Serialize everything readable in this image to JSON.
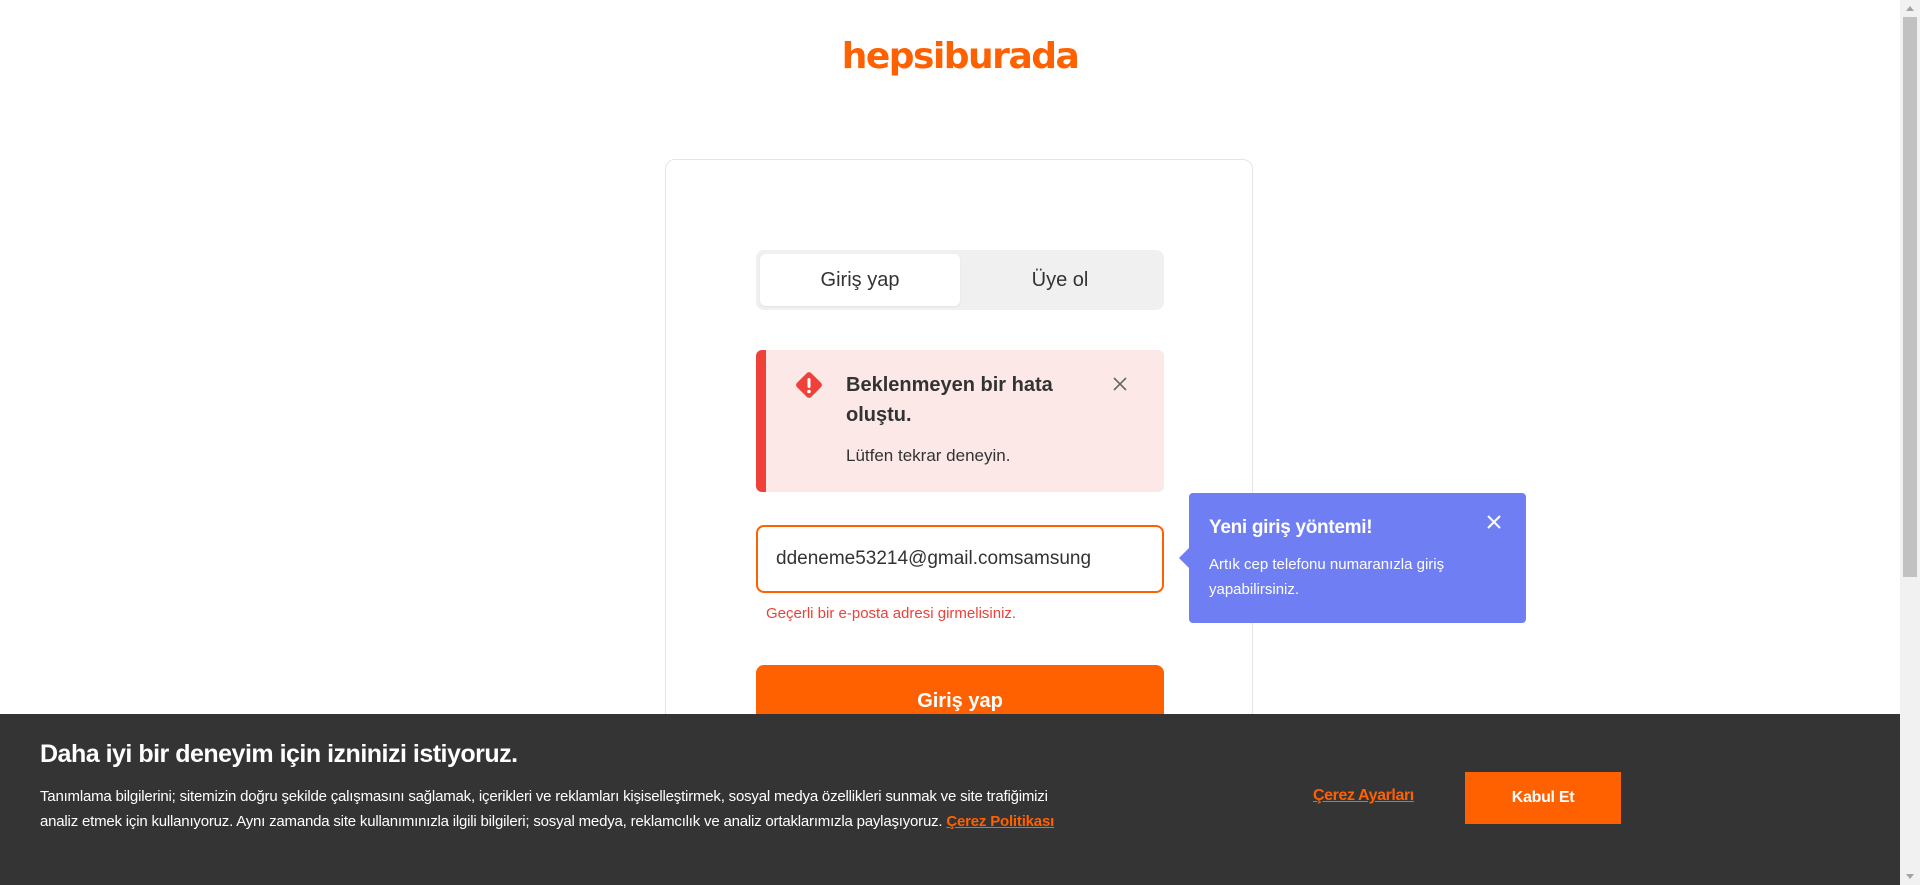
{
  "brand": {
    "logo_text": "hepsiburada",
    "accent_color": "#ff6000"
  },
  "tabs": [
    {
      "label": "Giriş yap",
      "active": true
    },
    {
      "label": "Üye ol",
      "active": false
    }
  ],
  "alert": {
    "title": "Beklenmeyen bir hata oluştu.",
    "message": "Lütfen tekrar deneyin.",
    "icon": "warning-icon",
    "close_icon": "close-icon",
    "color": "#f0403a"
  },
  "email_field": {
    "value": "ddeneme53214@gmail.comsamsung",
    "error": "Geçerli bir e-posta adresi girmelisiniz."
  },
  "tooltip": {
    "title": "Yeni giriş yöntemi!",
    "text": "Artık cep telefonu numaranızla giriş yapabilirsiniz.",
    "close_icon": "close-icon",
    "color": "#6f7ef3"
  },
  "submit_button": {
    "label": "Giriş yap"
  },
  "cookie_banner": {
    "title": "Daha iyi bir deneyim için izninizi istiyoruz.",
    "text": "Tanımlama bilgilerini; sitemizin doğru şekilde çalışmasını sağlamak, içerikleri ve reklamları kişiselleştirmek, sosyal medya özellikleri sunmak ve site trafiğimizi analiz etmek için kullanıyoruz. Aynı zamanda site kullanımınızla ilgili bilgileri; sosyal medya, reklamcılık ve analiz ortaklarımızla paylaşıyoruz.",
    "policy_link": "Çerez Politikası",
    "settings_link": "Çerez Ayarları",
    "accept_button": "Kabul Et"
  }
}
